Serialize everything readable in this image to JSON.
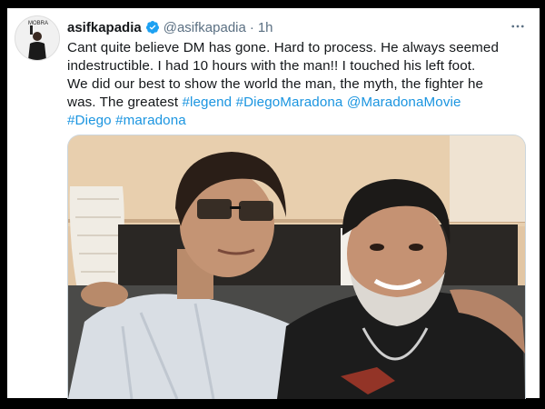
{
  "tweet": {
    "display_name": "asifkapadia",
    "handle": "@asifkapadia",
    "separator": "·",
    "time": "1h",
    "text_lines": [
      "Cant quite believe DM has gone. Hard to process. He always seemed",
      "indestructible. I had 10 hours with the man!! I touched his left foot.",
      "We did our best to show the world the man, the myth, the fighter he",
      "was. The greatest "
    ],
    "tags": [
      "#legend",
      "#DiegoMaradona",
      "@MaradonaMovie",
      "#Diego",
      "#maradona"
    ],
    "avatar_text": "MOBRA"
  },
  "colors": {
    "accent": "#1b95e0",
    "text": "#14171a",
    "muted": "#5b7083",
    "verified": "#1da1f2"
  },
  "icons": {
    "verified": "verified-badge-icon",
    "more": "more-options-icon"
  }
}
